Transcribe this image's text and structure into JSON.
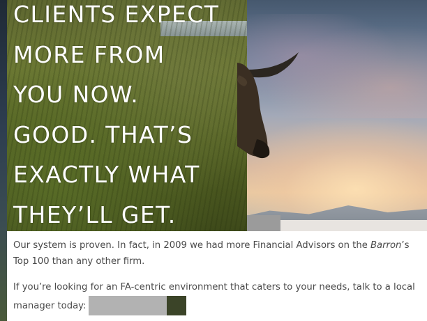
{
  "headline": {
    "lines": [
      "CLIENTS EXPECT",
      "MORE FROM",
      "YOU NOW.",
      "GOOD. THAT’S",
      "EXACTLY WHAT",
      "THEY’LL GET."
    ]
  },
  "body": {
    "para1_a": "Our system is proven. In fact, in 2009 we had more Financial Advisors on the ",
    "para1_em": "Barron",
    "para1_b": "’s Top 100 than any other firm.",
    "para2_a": "If you’re looking for an FA-centric environment that caters to your needs, talk to a local manager today:"
  },
  "colors": {
    "headline_text": "#ffffff",
    "body_text": "#4a4a4a",
    "redaction_gray": "#b2b2b2"
  }
}
